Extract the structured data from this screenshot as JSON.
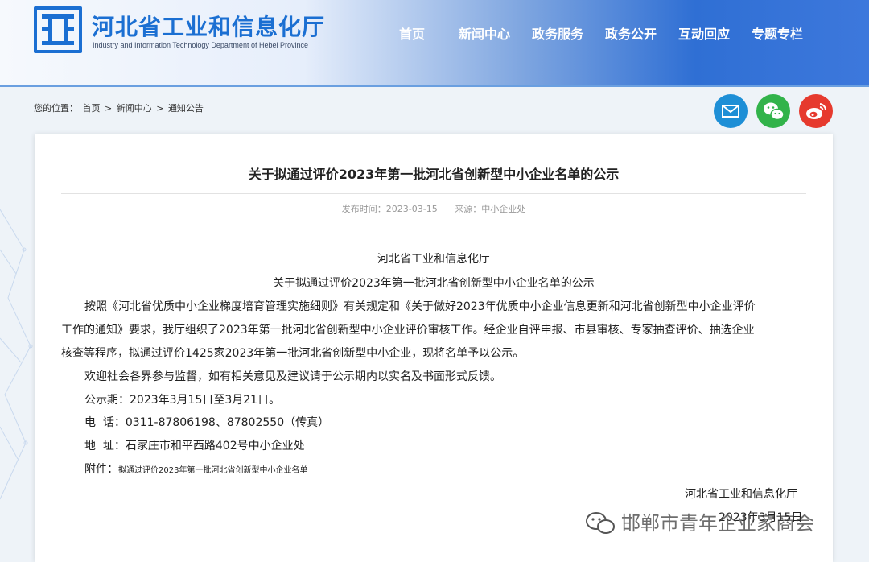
{
  "site": {
    "title": "河北省工业和信息化厅",
    "subtitle": "Industry and Information Technology Department of Hebei Province"
  },
  "nav": {
    "items": [
      {
        "label": "首页"
      },
      {
        "label": "新闻中心"
      },
      {
        "label": "政务服务"
      },
      {
        "label": "政务公开"
      },
      {
        "label": "互动回应"
      },
      {
        "label": "专题专栏"
      }
    ]
  },
  "breadcrumb": {
    "prefix": "您的位置：",
    "home": "首页",
    "sep": ">",
    "news": "新闻中心",
    "notice": "通知公告"
  },
  "social": {
    "icons": [
      "mail-icon",
      "wechat-icon",
      "weibo-icon"
    ],
    "colors": {
      "mail": "#1e8fd6",
      "wechat": "#32b34a",
      "weibo": "#e63a2e"
    }
  },
  "article": {
    "title": "关于拟通过评价2023年第一批河北省创新型中小企业名单的公示",
    "publish_label": "发布时间：",
    "publish_date": "2023-03-15",
    "source_label": "来源：",
    "source": "中小企业处",
    "issuer": "河北省工业和信息化厅",
    "heading": "关于拟通过评价2023年第一批河北省创新型中小企业名单的公示",
    "para1_line1": "按照《河北省优质中小企业梯度培育管理实施细则》有关规定和《关于做好2023年优质中小企业信息更新和河北省创新型中小企业评价",
    "para1_line2": "工作的通知》要求，我厅组织了2023年第一批河北省创新型中小企业评价审核工作。经企业自评申报、市县审核、专家抽查评价、抽选企业",
    "para1_line3": "核查等程序，拟通过评价1425家2023年第一批河北省创新型中小企业，现将名单予以公示。",
    "para2": "欢迎社会各界参与监督，如有相关意见及建议请于公示期内以实名及书面形式反馈。",
    "period": "公示期：2023年3月15日至3月21日。",
    "phone": "电  话：0311-87806198、87802550（传真）",
    "address": "地  址：石家庄市和平西路402号中小企业处",
    "attachment_label": "附件：",
    "attachment_file": "拟通过评价2023年第一批河北省创新型中小企业名单",
    "sign_org": "河北省工业和信息化厅",
    "sign_date": "2023年3月15日"
  },
  "watermark": {
    "text": "邯郸市青年企业家商会",
    "icon": "wechat-official-icon"
  }
}
